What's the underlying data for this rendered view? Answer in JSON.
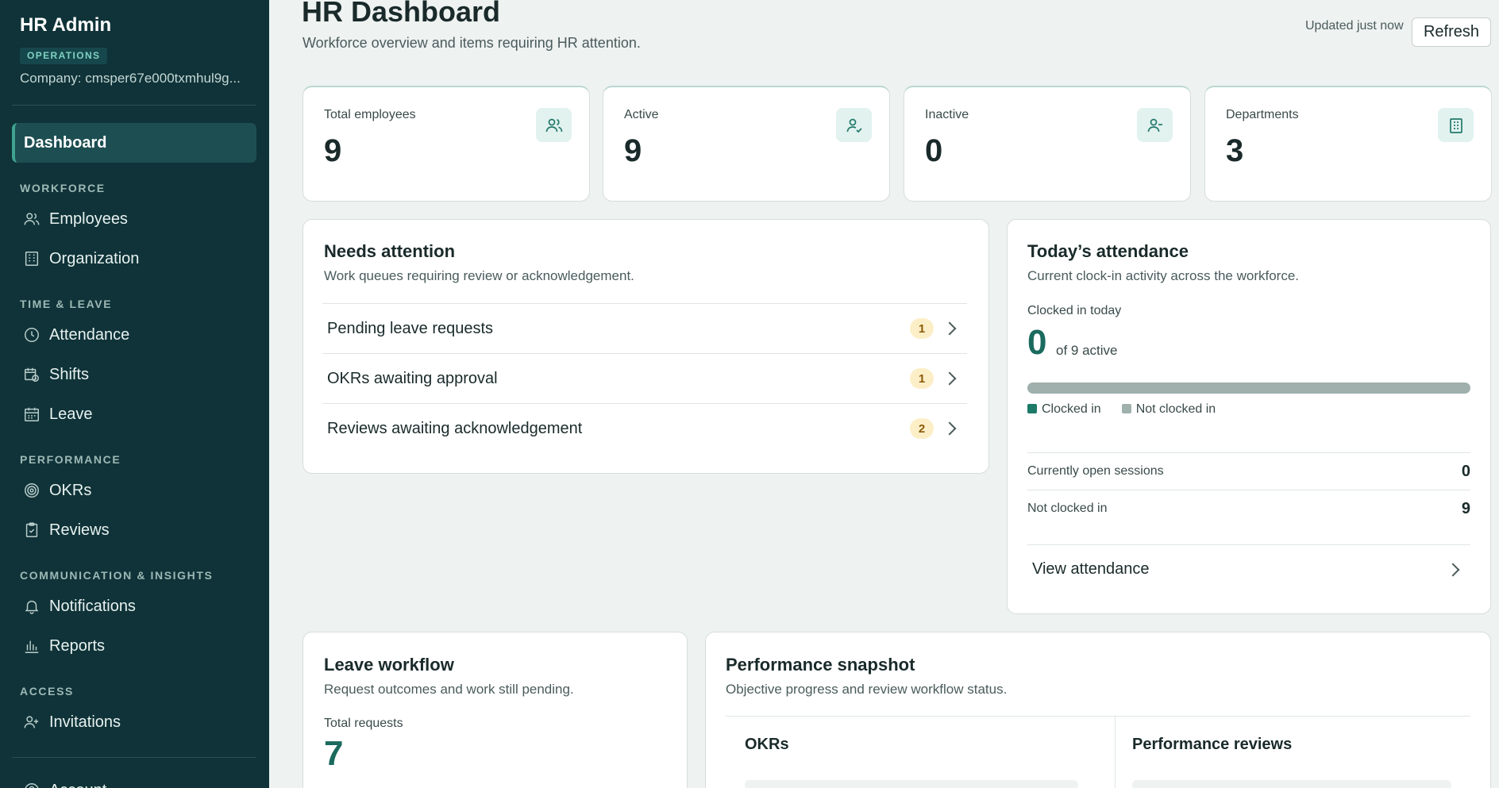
{
  "sidebar": {
    "title": "HR Admin",
    "badge": "OPERATIONS",
    "company": "Company: cmsper67e000txmhul9g...",
    "active_item": "Dashboard",
    "sections": {
      "workforce": "WORKFORCE",
      "time_leave": "TIME & LEAVE",
      "performance": "PERFORMANCE",
      "comms": "COMMUNICATION & INSIGHTS",
      "access": "ACCESS"
    },
    "items": {
      "employees": "Employees",
      "organization": "Organization",
      "attendance": "Attendance",
      "shifts": "Shifts",
      "leave": "Leave",
      "okrs": "OKRs",
      "reviews": "Reviews",
      "notifications": "Notifications",
      "reports": "Reports",
      "invitations": "Invitations",
      "account": "Account"
    }
  },
  "header": {
    "title": "HR Dashboard",
    "subtitle": "Workforce overview and items requiring HR attention.",
    "updated": "Updated just now",
    "refresh_label": "Refresh"
  },
  "stats": [
    {
      "label": "Total employees",
      "value": "9",
      "icon": "users-icon"
    },
    {
      "label": "Active",
      "value": "9",
      "icon": "user-check-icon"
    },
    {
      "label": "Inactive",
      "value": "0",
      "icon": "user-minus-icon"
    },
    {
      "label": "Departments",
      "value": "3",
      "icon": "building-icon"
    }
  ],
  "needs_attention": {
    "title": "Needs attention",
    "subtitle": "Work queues requiring review or acknowledgement.",
    "rows": [
      {
        "label": "Pending leave requests",
        "count": "1"
      },
      {
        "label": "OKRs awaiting approval",
        "count": "1"
      },
      {
        "label": "Reviews awaiting acknowledgement",
        "count": "2"
      }
    ]
  },
  "attendance": {
    "title": "Today’s attendance",
    "subtitle": "Current clock-in activity across the workforce.",
    "clocked_label": "Clocked in today",
    "clocked_value": "0",
    "of_active": "of 9 active",
    "progress_fraction": 0,
    "legend_clocked": "Clocked in",
    "legend_not": "Not clocked in",
    "open_sessions_label": "Currently open sessions",
    "open_sessions_value": "0",
    "not_clocked_label": "Not clocked in",
    "not_clocked_value": "9",
    "view_link": "View attendance",
    "colors": {
      "clocked": "#1b7a68",
      "not_clocked": "#9fb0ad"
    }
  },
  "leave_workflow": {
    "title": "Leave workflow",
    "subtitle": "Request outcomes and work still pending.",
    "total_label": "Total requests",
    "total_value": "7"
  },
  "performance": {
    "title": "Performance snapshot",
    "subtitle": "Objective progress and review workflow status.",
    "col_okrs": "OKRs",
    "col_reviews": "Performance reviews"
  }
}
